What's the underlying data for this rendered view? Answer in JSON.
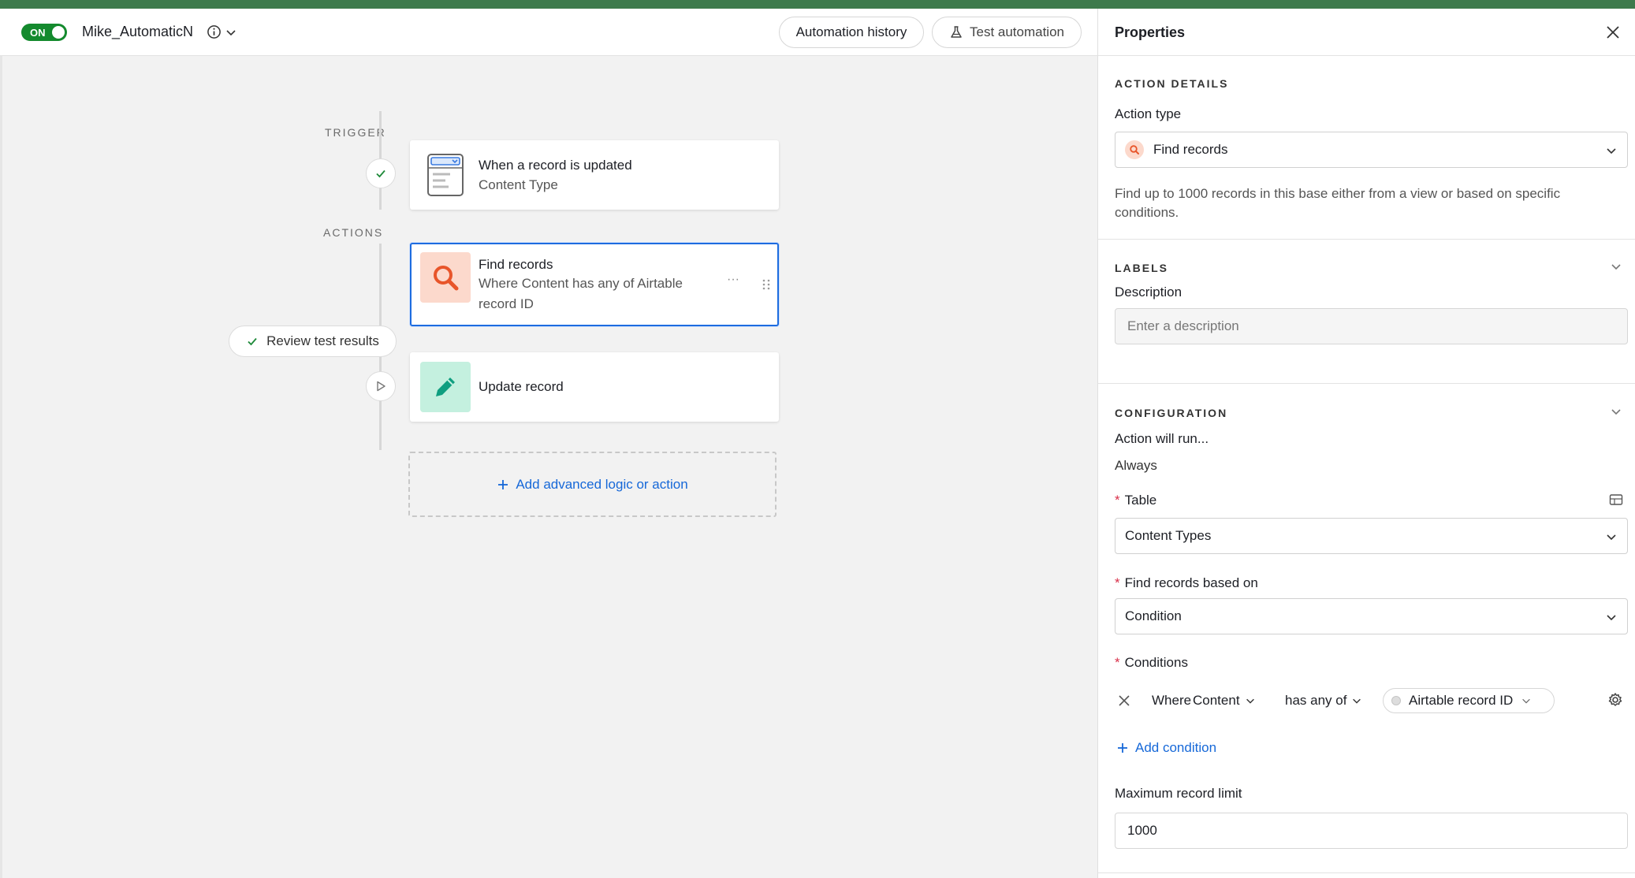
{
  "header": {
    "toggle_label": "ON",
    "automation_name": "Mike_AutomaticN",
    "history_button": "Automation history",
    "test_button": "Test automation"
  },
  "canvas": {
    "trigger_label": "TRIGGER",
    "actions_label": "ACTIONS",
    "trigger_card": {
      "title": "When a record is updated",
      "subtitle": "Content Type"
    },
    "find_card": {
      "title": "Find records",
      "subtitle": "Where Content has any of Airtable record ID"
    },
    "update_card": {
      "title": "Update record"
    },
    "review_pill": "Review test results",
    "add_action": "Add advanced logic or action"
  },
  "panel": {
    "title": "Properties",
    "action_details": {
      "section": "ACTION DETAILS",
      "action_type_label": "Action type",
      "action_type_value": "Find records",
      "description": "Find up to 1000 records in this base either from a view or based on specific conditions."
    },
    "labels": {
      "section": "LABELS",
      "description_label": "Description",
      "description_placeholder": "Enter a description"
    },
    "configuration": {
      "section": "CONFIGURATION",
      "run_label": "Action will run...",
      "run_value": "Always",
      "table_label": "Table",
      "table_value": "Content Types",
      "find_based_label": "Find records based on",
      "find_based_value": "Condition",
      "conditions_label": "Conditions",
      "condition": {
        "where": "Where",
        "field": "Content",
        "operator": "has any of",
        "value": "Airtable record ID"
      },
      "add_condition": "Add condition",
      "max_limit_label": "Maximum record limit",
      "max_limit_value": "1000"
    }
  },
  "colors": {
    "accent_green": "#3d7a4c",
    "toggle_green": "#148a2e",
    "link_blue": "#1668d8",
    "selected_border": "#1d6ce0",
    "find_icon_bg": "#fcd9cc",
    "update_icon_bg": "#c4f0df",
    "required_red": "#d9304a"
  }
}
